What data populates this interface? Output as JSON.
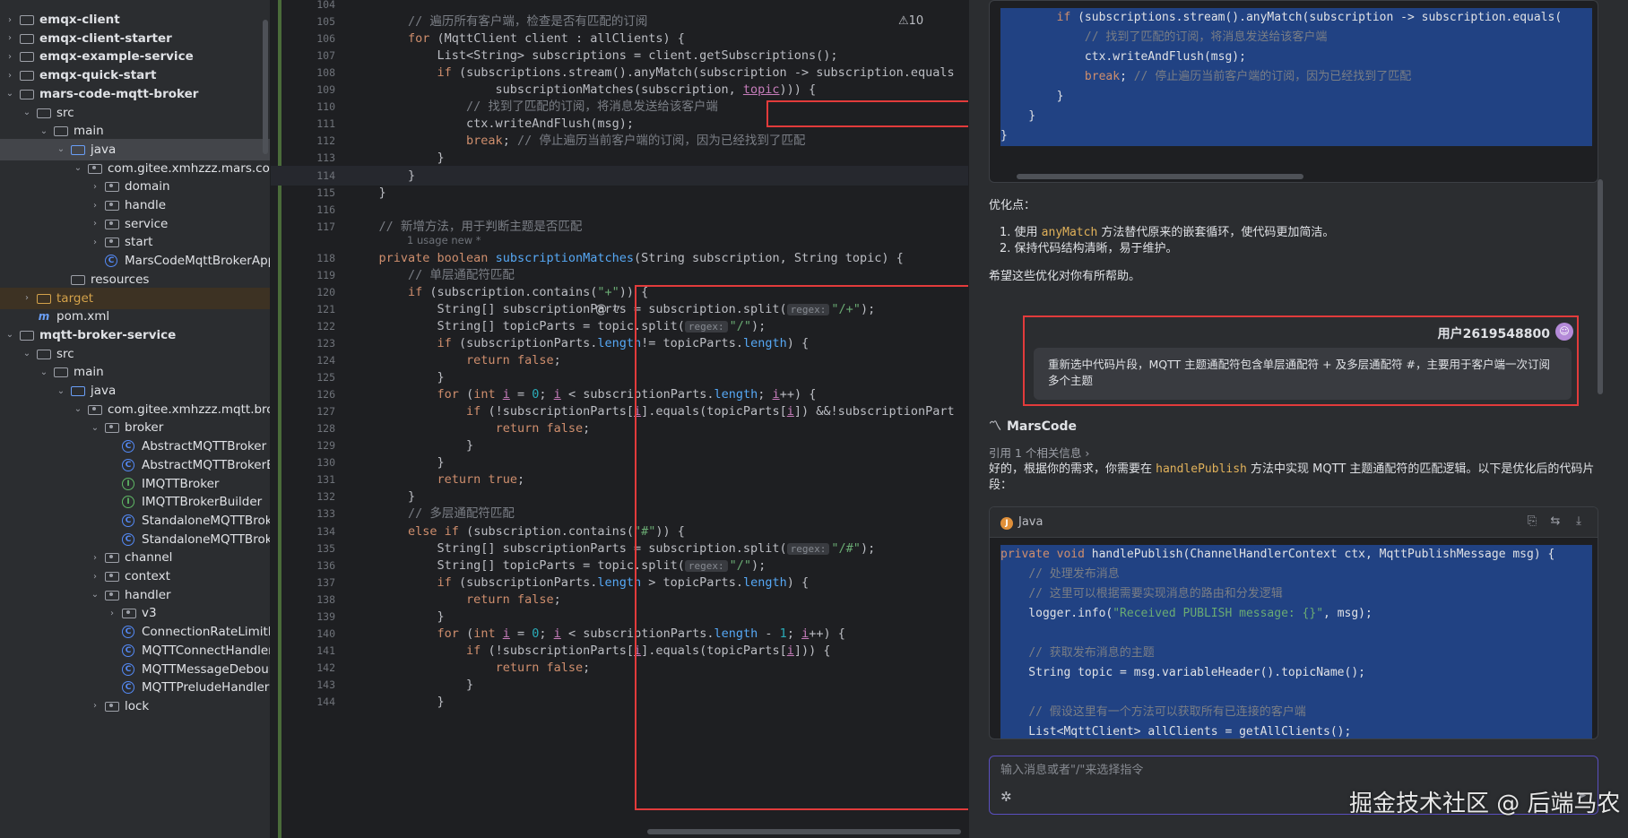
{
  "project_tree": {
    "items": [
      {
        "label": "emqx-client",
        "depth": 0,
        "chev": "›",
        "icon": "folder",
        "bold": true
      },
      {
        "label": "emqx-client-starter",
        "depth": 0,
        "chev": "›",
        "icon": "folder",
        "bold": true
      },
      {
        "label": "emqx-example-service",
        "depth": 0,
        "chev": "›",
        "icon": "folder",
        "bold": true
      },
      {
        "label": "emqx-quick-start",
        "depth": 0,
        "chev": "›",
        "icon": "folder",
        "bold": true
      },
      {
        "label": "mars-code-mqtt-broker",
        "depth": 0,
        "chev": "⌄",
        "icon": "folder",
        "bold": true
      },
      {
        "label": "src",
        "depth": 1,
        "chev": "⌄",
        "icon": "folder"
      },
      {
        "label": "main",
        "depth": 2,
        "chev": "⌄",
        "icon": "folder"
      },
      {
        "label": "java",
        "depth": 3,
        "chev": "⌄",
        "icon": "folder-blue",
        "selected": true
      },
      {
        "label": "com.gitee.xmhzzz.mars.code.",
        "depth": 4,
        "chev": "⌄",
        "icon": "package"
      },
      {
        "label": "domain",
        "depth": 5,
        "chev": "›",
        "icon": "package"
      },
      {
        "label": "handle",
        "depth": 5,
        "chev": "›",
        "icon": "package"
      },
      {
        "label": "service",
        "depth": 5,
        "chev": "›",
        "icon": "package"
      },
      {
        "label": "start",
        "depth": 5,
        "chev": "›",
        "icon": "package"
      },
      {
        "label": "MarsCodeMqttBrokerAppli",
        "depth": 5,
        "chev": "",
        "icon": "class"
      },
      {
        "label": "resources",
        "depth": 3,
        "chev": "",
        "icon": "folder"
      },
      {
        "label": "target",
        "depth": 1,
        "chev": "›",
        "icon": "folder-orange",
        "excluded": true
      },
      {
        "label": "pom.xml",
        "depth": 1,
        "chev": "",
        "icon": "maven"
      },
      {
        "label": "mqtt-broker-service",
        "depth": 0,
        "chev": "⌄",
        "icon": "folder",
        "bold": true
      },
      {
        "label": "src",
        "depth": 1,
        "chev": "⌄",
        "icon": "folder"
      },
      {
        "label": "main",
        "depth": 2,
        "chev": "⌄",
        "icon": "folder"
      },
      {
        "label": "java",
        "depth": 3,
        "chev": "⌄",
        "icon": "folder-blue"
      },
      {
        "label": "com.gitee.xmhzzz.mqtt.broke",
        "depth": 4,
        "chev": "⌄",
        "icon": "package"
      },
      {
        "label": "broker",
        "depth": 5,
        "chev": "⌄",
        "icon": "package"
      },
      {
        "label": "AbstractMQTTBroker",
        "depth": 6,
        "chev": "",
        "icon": "class"
      },
      {
        "label": "AbstractMQTTBrokerBu",
        "depth": 6,
        "chev": "",
        "icon": "class"
      },
      {
        "label": "IMQTTBroker",
        "depth": 6,
        "chev": "",
        "icon": "interface"
      },
      {
        "label": "IMQTTBrokerBuilder",
        "depth": 6,
        "chev": "",
        "icon": "interface"
      },
      {
        "label": "StandaloneMQTTBroker",
        "depth": 6,
        "chev": "",
        "icon": "class"
      },
      {
        "label": "StandaloneMQTTBroker",
        "depth": 6,
        "chev": "",
        "icon": "class"
      },
      {
        "label": "channel",
        "depth": 5,
        "chev": "›",
        "icon": "package"
      },
      {
        "label": "context",
        "depth": 5,
        "chev": "›",
        "icon": "package"
      },
      {
        "label": "handler",
        "depth": 5,
        "chev": "⌄",
        "icon": "package"
      },
      {
        "label": "v3",
        "depth": 6,
        "chev": "›",
        "icon": "package"
      },
      {
        "label": "ConnectionRateLimitHa",
        "depth": 6,
        "chev": "",
        "icon": "class"
      },
      {
        "label": "MQTTConnectHandler",
        "depth": 6,
        "chev": "",
        "icon": "class"
      },
      {
        "label": "MQTTMessageDebounc",
        "depth": 6,
        "chev": "",
        "icon": "class"
      },
      {
        "label": "MQTTPreludeHandler",
        "depth": 6,
        "chev": "",
        "icon": "class"
      },
      {
        "label": "lock",
        "depth": 5,
        "chev": "›",
        "icon": "package"
      }
    ]
  },
  "editor": {
    "warnings": "⚠10",
    "usage_hint": "1 usage   new *",
    "lines": [
      {
        "n": "104",
        "html": ""
      },
      {
        "n": "105",
        "html": "        <span class='cmt'>// 遍历所有客户端，检查是否有匹配的订阅</span>"
      },
      {
        "n": "106",
        "html": "        <span class='kw'>for</span> (MqttClient client : allClients) {"
      },
      {
        "n": "107",
        "html": "            List&lt;String&gt; subscriptions = client.getSubscriptions();"
      },
      {
        "n": "108",
        "html": "            <span class='kw'>if</span> (subscriptions.stream().anyMatch(subscription -&gt; subscription.equals"
      },
      {
        "n": "109",
        "html": "                    subscriptionMatches(subscription, <span class='und'>topic</span>))) {"
      },
      {
        "n": "110",
        "html": "                <span class='cmt'>// 找到了匹配的订阅，将消息发送给该客户端</span>"
      },
      {
        "n": "111",
        "html": "                ctx.writeAndFlush(msg);"
      },
      {
        "n": "112",
        "html": "                <span class='kw'>break</span>; <span class='cmt'>// 停止遍历当前客户端的订阅，因为已经找到了匹配</span>"
      },
      {
        "n": "113",
        "html": "            }"
      },
      {
        "n": "114",
        "html": "        }",
        "cur": true
      },
      {
        "n": "115",
        "html": "    }"
      },
      {
        "n": "116",
        "html": ""
      },
      {
        "n": "117",
        "html": "    <span class='cmt'>// 新增方法，用于判断主题是否匹配</span>"
      },
      {
        "n": "118",
        "html": "    <span class='kw'>private boolean</span> <span class='fn'>subscriptionMatches</span>(String subscription, String topic) {"
      },
      {
        "n": "119",
        "html": "        <span class='cmt'>// 单层通配符匹配</span>"
      },
      {
        "n": "120",
        "html": "        <span class='kw'>if</span> (subscription.contains(<span class='str'>\"+\"</span>)) {"
      },
      {
        "n": "121",
        "html": "            String[] subscriptionParts = subscription.split(<span class='hint'>regex:</span><span class='str'>\"/+\"</span>);"
      },
      {
        "n": "122",
        "html": "            String[] topicParts = topic.split(<span class='hint'>regex:</span><span class='str'>\"/\"</span>);"
      },
      {
        "n": "123",
        "html": "            <span class='kw'>if</span> (subscriptionParts.<span class='fn'>length</span>!= topicParts.<span class='fn'>length</span>) {"
      },
      {
        "n": "124",
        "html": "                <span class='kw'>return false</span>;"
      },
      {
        "n": "125",
        "html": "            }"
      },
      {
        "n": "126",
        "html": "            <span class='kw'>for</span> (<span class='kw'>int</span> <span class='und'>i</span> = <span class='num'>0</span>; <span class='und'>i</span> &lt; subscriptionParts.<span class='fn'>length</span>; <span class='und'>i</span>++) {"
      },
      {
        "n": "127",
        "html": "                <span class='kw'>if</span> (!subscriptionParts[<span class='und'>i</span>].equals(topicParts[<span class='und'>i</span>]) &amp;&amp;!subscriptionPart"
      },
      {
        "n": "128",
        "html": "                    <span class='kw'>return false</span>;"
      },
      {
        "n": "129",
        "html": "                }"
      },
      {
        "n": "130",
        "html": "            }"
      },
      {
        "n": "131",
        "html": "            <span class='kw'>return true</span>;"
      },
      {
        "n": "132",
        "html": "        }"
      },
      {
        "n": "133",
        "html": "        <span class='cmt'>// 多层通配符匹配</span>"
      },
      {
        "n": "134",
        "html": "        <span class='kw'>else if</span> (subscription.contains(<span class='str'>\"#\"</span>)) {"
      },
      {
        "n": "135",
        "html": "            String[] subscriptionParts = subscription.split(<span class='hint'>regex:</span><span class='str'>\"/#\"</span>);"
      },
      {
        "n": "136",
        "html": "            String[] topicParts = topic.split(<span class='hint'>regex:</span><span class='str'>\"/\"</span>);"
      },
      {
        "n": "137",
        "html": "            <span class='kw'>if</span> (subscriptionParts.<span class='fn'>length</span> &gt; topicParts.<span class='fn'>length</span>) {"
      },
      {
        "n": "138",
        "html": "                <span class='kw'>return false</span>;"
      },
      {
        "n": "139",
        "html": "            }"
      },
      {
        "n": "140",
        "html": "            <span class='kw'>for</span> (<span class='kw'>int</span> <span class='und'>i</span> = <span class='num'>0</span>; <span class='und'>i</span> &lt; subscriptionParts.<span class='fn'>length</span> - <span class='num'>1</span>; <span class='und'>i</span>++) {"
      },
      {
        "n": "141",
        "html": "                <span class='kw'>if</span> (!subscriptionParts[<span class='und'>i</span>].equals(topicParts[<span class='und'>i</span>])) {"
      },
      {
        "n": "142",
        "html": "                    <span class='kw'>return false</span>;"
      },
      {
        "n": "143",
        "html": "                }"
      },
      {
        "n": "144",
        "html": "            }"
      }
    ]
  },
  "chat": {
    "top_code": [
      {
        "html": "        <span class='kw'>if</span> (subscriptions.stream().anyMatch(subscription -&gt; subscription.equals("
      },
      {
        "html": "            <span class='cmt'>// 找到了匹配的订阅，将消息发送给该客户端</span>"
      },
      {
        "html": "            ctx.writeAndFlush(msg);"
      },
      {
        "html": "            <span class='kw'>break</span>; <span class='cmt'>// 停止遍历当前客户端的订阅，因为已经找到了匹配</span>"
      },
      {
        "html": "        }"
      },
      {
        "html": "    }"
      },
      {
        "html": "}"
      }
    ],
    "optimization_title": "优化点：",
    "point1_pre": "1. 使用 ",
    "point1_code": "anyMatch",
    "point1_post": " 方法替代原来的嵌套循环，使代码更加简洁。",
    "point2": "2. 保持代码结构清晰，易于维护。",
    "hope": "希望这些优化对你有所帮助。",
    "user_name": "用户2619548800",
    "user_message": "重新选中代码片段，MQTT 主题通配符包含单层通配符 + 及多层通配符 #，主要用于客户端一次订阅多个主题",
    "assistant_name": "MarsCode",
    "ref_info": "引用 1 个相关信息 ›",
    "answer_pre": "好的，根据你的需求，你需要在 ",
    "answer_code": "handlePublish",
    "answer_post": " 方法中实现 MQTT 主题通配符的匹配逻辑。以下是优化后的代码片段：",
    "code_lang": "Java",
    "answer_code_lines": [
      {
        "html": "<span class='kw'>private void</span> handlePublish(ChannelHandlerContext ctx, MqttPublishMessage msg) {"
      },
      {
        "html": "    <span class='cmt'>// 处理发布消息</span>"
      },
      {
        "html": "    <span class='cmt'>// 这里可以根据需要实现消息的路由和分发逻辑</span>"
      },
      {
        "html": "    logger.info(<span class='str'>\"Received PUBLISH message: {}\"</span>, msg);"
      },
      {
        "html": ""
      },
      {
        "html": "    <span class='cmt'>// 获取发布消息的主题</span>"
      },
      {
        "html": "    String topic = msg.variableHeader().topicName();"
      },
      {
        "html": ""
      },
      {
        "html": "    <span class='cmt'>// 假设这里有一个方法可以获取所有已连接的客户端</span>"
      },
      {
        "html": "    List&lt;MqttClient&gt; allClients = getAllClients();"
      }
    ],
    "input_placeholder": "输入消息或者\"/\"来选择指令"
  },
  "watermark": "掘金技术社区 @ 后端马农"
}
